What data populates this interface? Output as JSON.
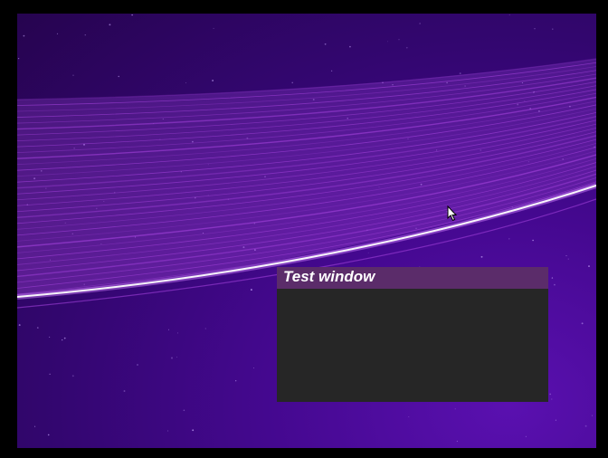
{
  "screen": {
    "background_color": "#000000"
  },
  "desktop": {
    "wallpaper_colors": {
      "base_dark": "#26044f",
      "base_light": "#5a10b0",
      "streak": "#a040d8",
      "streak_bright": "#ffffff"
    }
  },
  "window": {
    "title": "Test window",
    "titlebar_color": "#5b2c6a",
    "body_color": "#262626"
  },
  "cursor": {
    "icon": "arrow-pointer-icon"
  }
}
